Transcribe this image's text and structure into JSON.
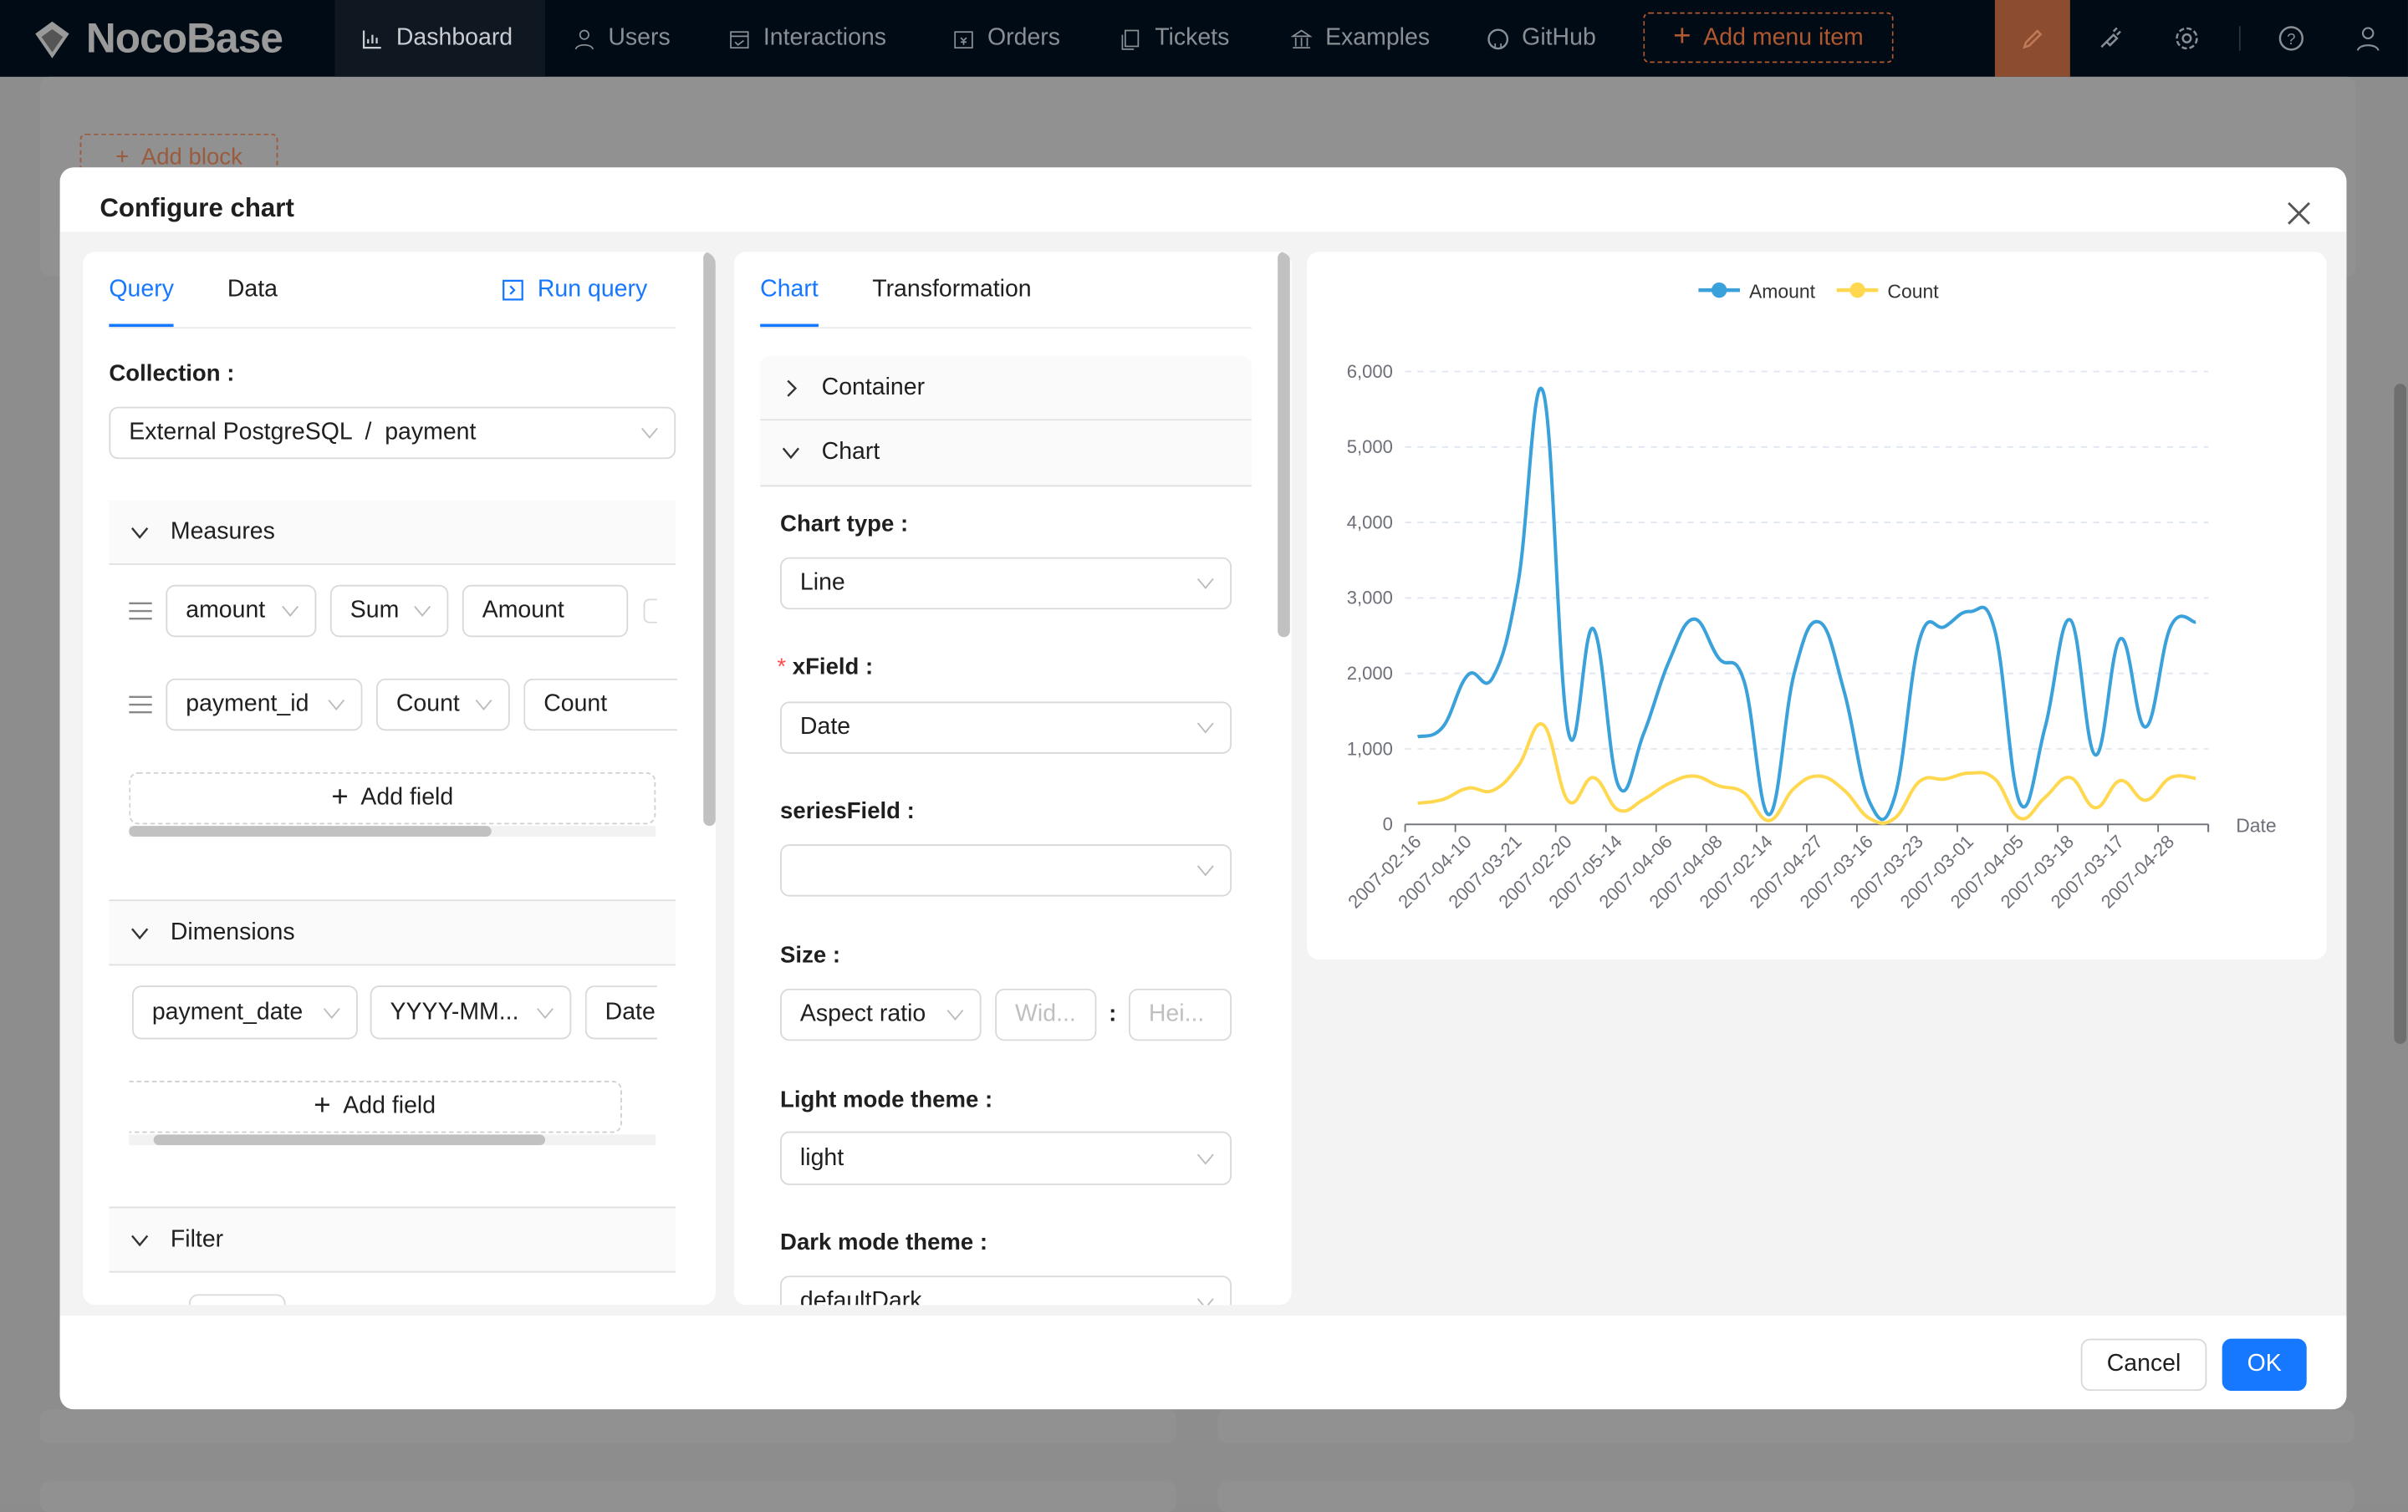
{
  "topbar": {
    "logo": "NocoBase",
    "nav": [
      {
        "label": "Dashboard",
        "icon": "bar-chart-icon",
        "active": true
      },
      {
        "label": "Users",
        "icon": "user-icon"
      },
      {
        "label": "Interactions",
        "icon": "calendar-icon"
      },
      {
        "label": "Orders",
        "icon": "yen-calendar-icon"
      },
      {
        "label": "Tickets",
        "icon": "copy-icon"
      },
      {
        "label": "Examples",
        "icon": "bank-icon"
      },
      {
        "label": "GitHub",
        "icon": "github-icon"
      }
    ],
    "add_menu_item": "Add menu item",
    "right_icons": [
      "highlight-icon",
      "plugin-icon",
      "settings-icon",
      "help-icon",
      "user-icon"
    ]
  },
  "page": {
    "add_block": "Add block"
  },
  "modal": {
    "title": "Configure chart",
    "cancel": "Cancel",
    "ok": "OK",
    "primary_color": "#1677ff"
  },
  "query_panel": {
    "tabs": [
      "Query",
      "Data"
    ],
    "active_tab": "Query",
    "run_query": "Run query",
    "collection_label": "Collection",
    "collection_value": "External PostgreSQL  /  payment",
    "measures": {
      "title": "Measures",
      "rows": [
        {
          "field": "amount",
          "aggregation": "Sum",
          "alias": "Amount"
        },
        {
          "field": "payment_id",
          "aggregation": "Count",
          "alias": "Count"
        }
      ],
      "add_field": "Add field"
    },
    "dimensions": {
      "title": "Dimensions",
      "rows": [
        {
          "field": "payment_date",
          "format": "YYYY-MM...",
          "alias": "Date"
        }
      ],
      "add_field": "Add field"
    },
    "filter": {
      "title": "Filter"
    }
  },
  "chart_panel": {
    "tabs": [
      "Chart",
      "Transformation"
    ],
    "active_tab": "Chart",
    "sections": {
      "container": "Container",
      "chart": "Chart"
    },
    "chart_type_label": "Chart type",
    "chart_type": "Line",
    "xfield_label": "xField",
    "xfield": "Date",
    "series_field_label": "seriesField",
    "series_field": "",
    "size_label": "Size",
    "size_mode": "Aspect ratio",
    "width_placeholder": "Wid...",
    "height_placeholder": "Hei...",
    "size_sep": ":",
    "light_theme_label": "Light mode theme",
    "light_theme": "light",
    "dark_theme_label": "Dark mode theme",
    "dark_theme": "defaultDark"
  },
  "chart_data": {
    "type": "line",
    "smooth": true,
    "xlabel": "Date",
    "ylabel": "",
    "ylim": [
      0,
      6000
    ],
    "yticks": [
      0,
      1000,
      2000,
      3000,
      4000,
      5000,
      6000
    ],
    "ytick_labels": [
      "0",
      "1,000",
      "2,000",
      "3,000",
      "4,000",
      "5,000",
      "6,000"
    ],
    "grid": "horizontal dashed",
    "legend": "top-center",
    "categories": [
      "2007-02-16",
      "",
      "2007-04-10",
      "",
      "2007-03-21",
      "",
      "2007-02-20",
      "",
      "2007-05-14",
      "",
      "2007-04-06",
      "",
      "2007-04-08",
      "",
      "2007-02-14",
      "",
      "2007-04-27",
      "",
      "2007-03-16",
      "",
      "2007-03-23",
      "",
      "2007-03-01",
      "",
      "2007-04-05",
      "",
      "2007-03-18",
      "",
      "2007-03-17",
      "",
      "2007-04-28",
      ""
    ],
    "series": [
      {
        "name": "Amount",
        "color": "#3ba1db",
        "values": [
          1160,
          1290,
          1980,
          1950,
          3200,
          5730,
          1230,
          2590,
          510,
          1200,
          2150,
          2720,
          2200,
          1900,
          130,
          2000,
          2680,
          1750,
          300,
          360,
          2450,
          2620,
          2820,
          2560,
          280,
          1290,
          2710,
          920,
          2460,
          1290,
          2620,
          2680
        ]
      },
      {
        "name": "Count",
        "color": "#ffd84f",
        "values": [
          280,
          330,
          480,
          450,
          770,
          1320,
          310,
          620,
          190,
          330,
          540,
          640,
          510,
          420,
          50,
          480,
          640,
          450,
          80,
          80,
          570,
          600,
          680,
          600,
          80,
          360,
          620,
          220,
          580,
          320,
          620,
          610
        ]
      }
    ]
  }
}
